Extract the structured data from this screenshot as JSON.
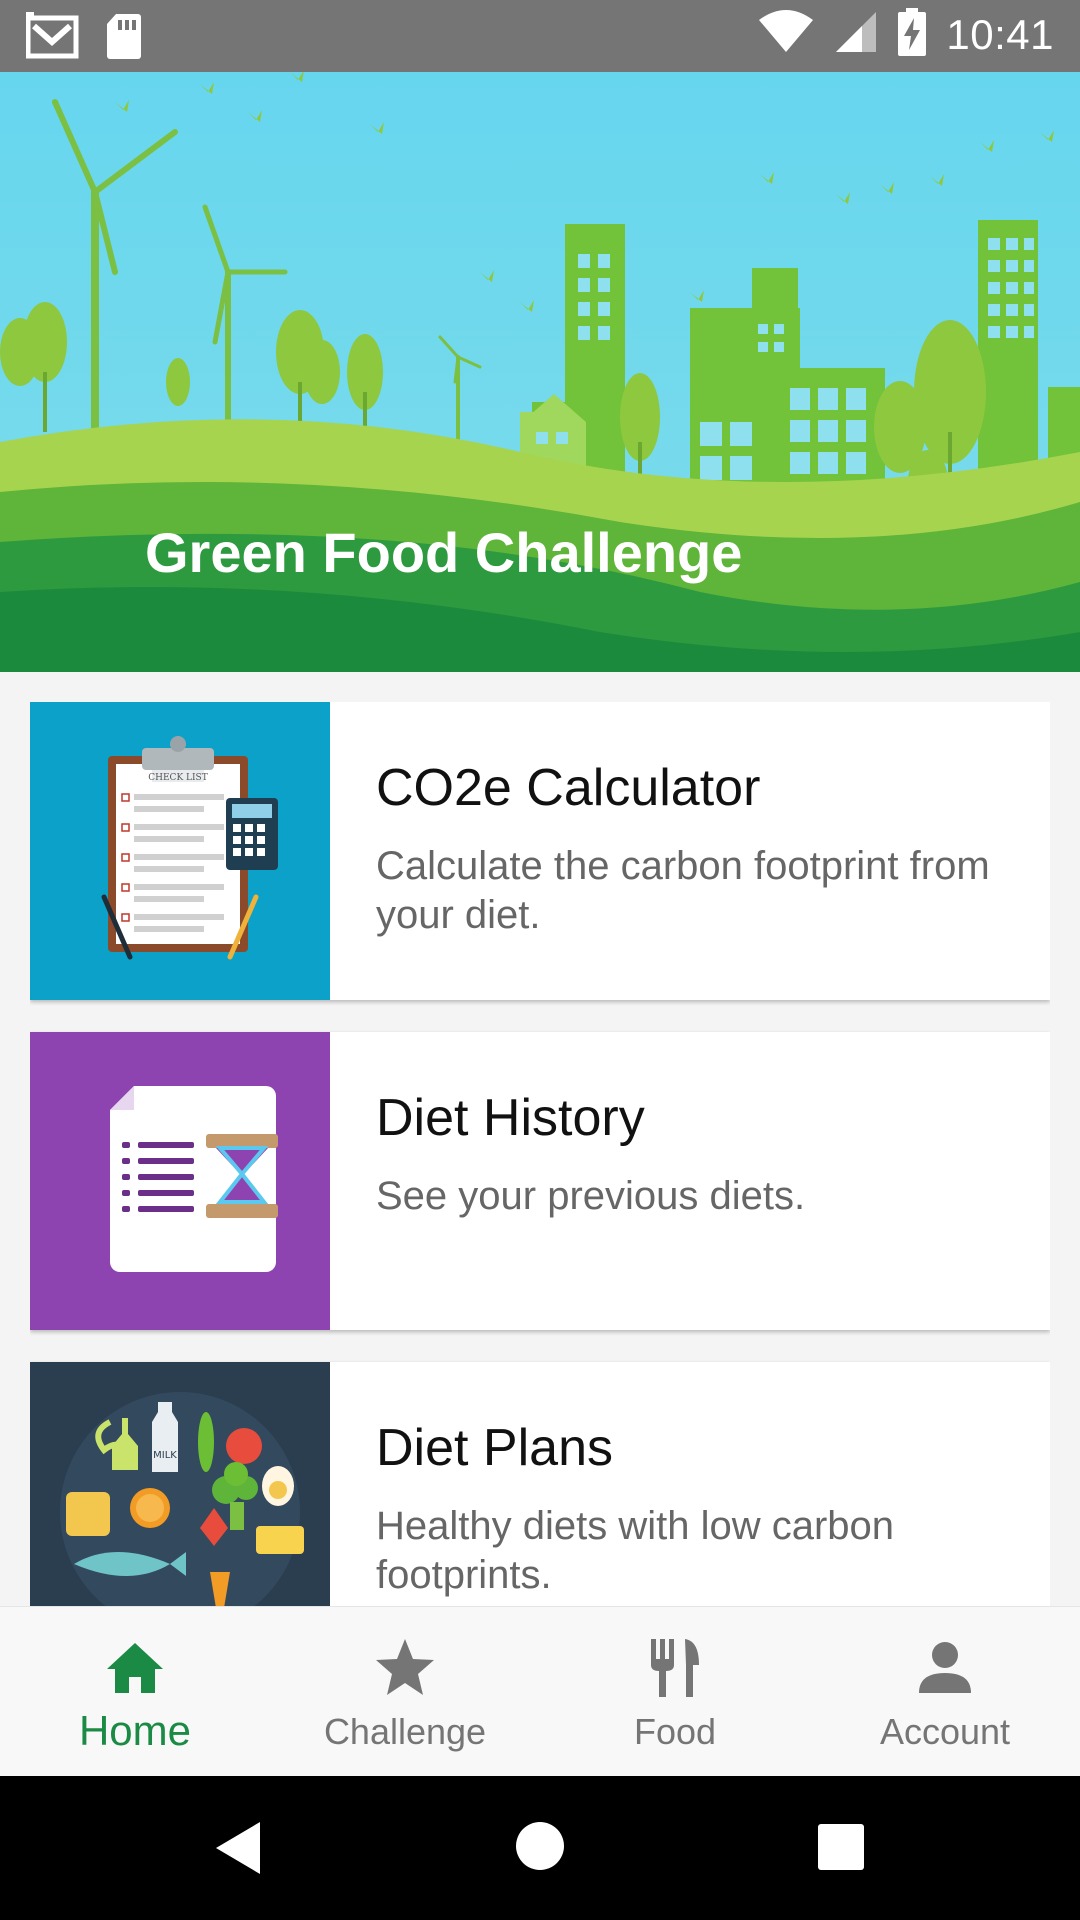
{
  "status_bar": {
    "time": "10:41",
    "icons": [
      "gmail-icon",
      "sd-card-icon",
      "wifi-icon",
      "signal-icon",
      "battery-charging-icon"
    ]
  },
  "hero": {
    "title": "Green Food Challenge",
    "colors": {
      "sky": "#6cd9ec",
      "grass_dark": "#1c8a3c",
      "grass_light": "#8dc83f",
      "building": "#6cbf35"
    }
  },
  "cards": [
    {
      "title": "CO2e Calculator",
      "description": "Calculate the carbon footprint from your diet.",
      "thumb_color": "#0ca1c9",
      "thumb_icon": "checklist-calculator-icon",
      "checklist_label": "CHECK LIST"
    },
    {
      "title": "Diet History",
      "description": "See your previous diets.",
      "thumb_color": "#8e44b0",
      "thumb_icon": "document-hourglass-icon"
    },
    {
      "title": "Diet Plans",
      "description": "Healthy diets with low carbon footprints.",
      "thumb_color": "#2b3e50",
      "thumb_icon": "food-assortment-icon",
      "milk_label": "MILK"
    }
  ],
  "bottom_nav": {
    "active_color": "#1a8a45",
    "inactive_color": "#757575",
    "items": [
      {
        "label": "Home",
        "icon": "home-icon",
        "active": true
      },
      {
        "label": "Challenge",
        "icon": "star-icon",
        "active": false
      },
      {
        "label": "Food",
        "icon": "fork-knife-icon",
        "active": false
      },
      {
        "label": "Account",
        "icon": "person-icon",
        "active": false
      }
    ]
  },
  "system_nav": {
    "icons": [
      "back-icon",
      "home-circle-icon",
      "recents-icon"
    ]
  }
}
